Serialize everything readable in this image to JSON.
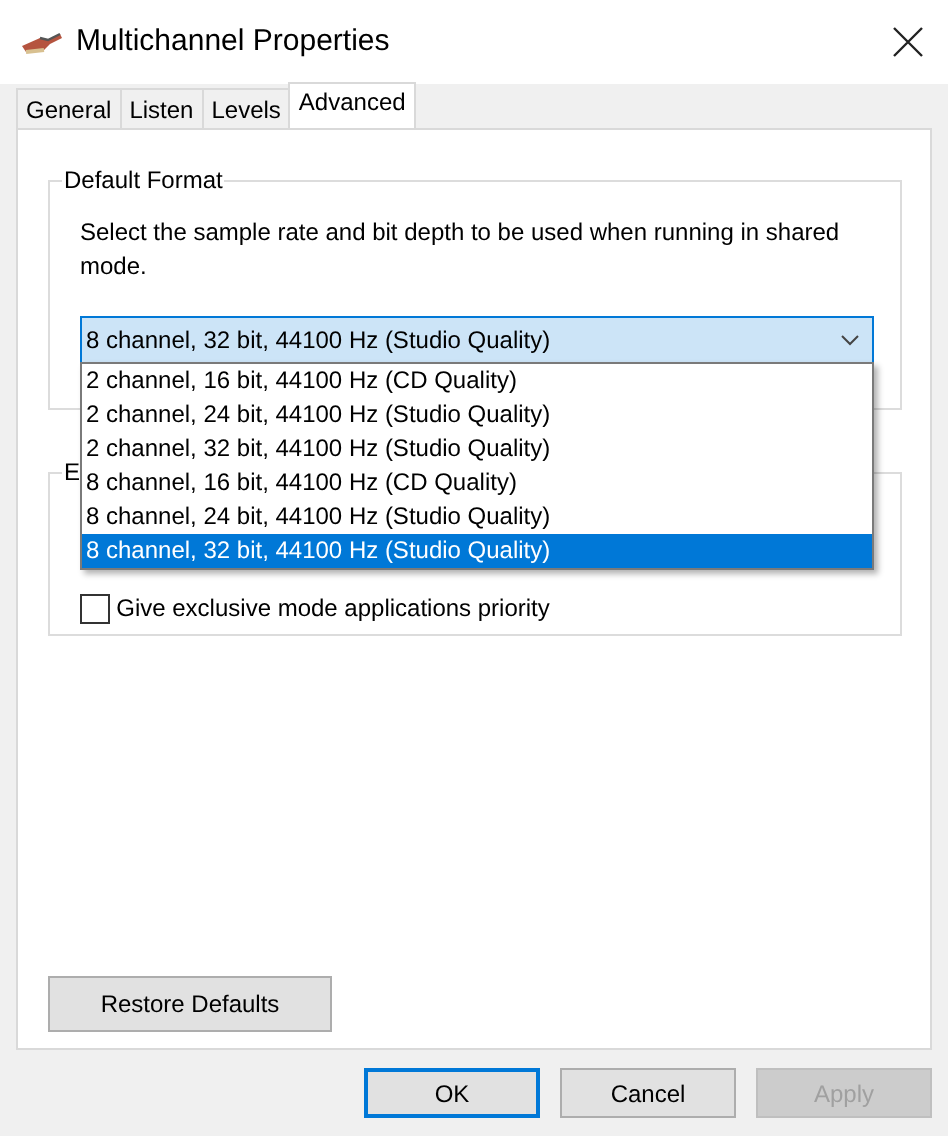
{
  "window": {
    "title": "Multichannel Properties"
  },
  "tabs": [
    {
      "label": "General",
      "selected": false
    },
    {
      "label": "Listen",
      "selected": false
    },
    {
      "label": "Levels",
      "selected": false
    },
    {
      "label": "Advanced",
      "selected": true
    }
  ],
  "default_format": {
    "title": "Default Format",
    "description": "Select the sample rate and bit depth to be used when running in shared mode.",
    "dropdown": {
      "value": "8 channel, 32 bit, 44100 Hz (Studio Quality)",
      "expanded": true,
      "options": [
        {
          "label": "2 channel, 16 bit, 44100 Hz (CD Quality)",
          "selected": false
        },
        {
          "label": "2 channel, 24 bit, 44100 Hz (Studio Quality)",
          "selected": false
        },
        {
          "label": "2 channel, 32 bit, 44100 Hz (Studio Quality)",
          "selected": false
        },
        {
          "label": "8 channel, 16 bit, 44100 Hz (CD Quality)",
          "selected": false
        },
        {
          "label": "8 channel, 24 bit, 44100 Hz (Studio Quality)",
          "selected": false
        },
        {
          "label": "8 channel, 32 bit, 44100 Hz (Studio Quality)",
          "selected": true
        }
      ]
    }
  },
  "exclusive_mode": {
    "title": "E",
    "options": [
      {
        "label": "Give exclusive mode applications priority",
        "checked": false
      }
    ]
  },
  "restore_button": "Restore Defaults",
  "buttons": [
    {
      "label": "OK",
      "kind": "default",
      "disabled": false
    },
    {
      "label": "Cancel",
      "kind": "normal",
      "disabled": false
    },
    {
      "label": "Apply",
      "kind": "normal",
      "disabled": true
    }
  ]
}
